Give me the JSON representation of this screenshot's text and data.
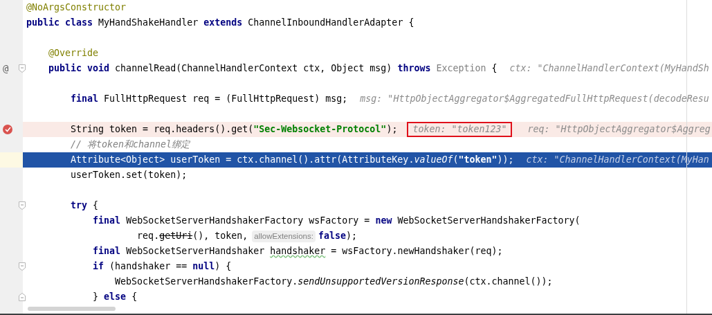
{
  "editor": {
    "lines": [
      {
        "pieces": [
          {
            "kind": "code",
            "tokens": [
              {
                "kind": "annotation",
                "text": "@NoArgsConstructor"
              }
            ]
          }
        ]
      },
      {
        "pieces": [
          {
            "kind": "code",
            "tokens": [
              {
                "kind": "keyword",
                "text": "public class "
              },
              {
                "kind": "plain",
                "text": "MyHandShakeHandler "
              },
              {
                "kind": "keyword",
                "text": "extends "
              },
              {
                "kind": "plain",
                "text": "ChannelInboundHandlerAdapter {"
              }
            ]
          }
        ]
      },
      {
        "gap_above": true,
        "pieces": [
          {
            "kind": "code",
            "tokens": [
              {
                "kind": "annotation",
                "text": "    @Override"
              }
            ]
          }
        ]
      },
      {
        "gutter_text": "@",
        "fold_open": true,
        "pieces": [
          {
            "kind": "code",
            "tokens": [
              {
                "kind": "keyword",
                "text": "    public void "
              },
              {
                "kind": "plain",
                "text": "channelRead(ChannelHandlerContext ctx, Object msg) "
              },
              {
                "kind": "keyword",
                "text": "throws "
              },
              {
                "kind": "dim",
                "text": "Exception "
              },
              {
                "kind": "plain",
                "text": "{"
              }
            ]
          },
          {
            "kind": "inline_value",
            "outlined": false,
            "text": "ctx: \"ChannelHandlerContext(MyHandSh"
          }
        ]
      },
      {
        "gap_above": true,
        "pieces": [
          {
            "kind": "code",
            "tokens": [
              {
                "kind": "keyword",
                "text": "        final "
              },
              {
                "kind": "plain",
                "text": "FullHttpRequest req = (FullHttpRequest) msg;"
              }
            ]
          },
          {
            "kind": "inline_value",
            "outlined": false,
            "text": "msg: \"HttpObjectAggregator$AggregatedFullHttpRequest(decodeResu"
          }
        ]
      },
      {
        "gap_above": true,
        "breakpoint": true,
        "pieces": [
          {
            "kind": "code",
            "tokens": [
              {
                "kind": "plain",
                "text": "        String token = req.headers().get("
              },
              {
                "kind": "string",
                "text": "\"Sec-Websocket-Protocol\""
              },
              {
                "kind": "plain",
                "text": ");"
              }
            ]
          },
          {
            "kind": "inline_value",
            "outlined": true,
            "text": "token: \"token123\""
          },
          {
            "kind": "inline_value",
            "outlined": false,
            "text": "req: \"HttpObjectAggregator$Aggreg"
          }
        ]
      },
      {
        "pieces": [
          {
            "kind": "code",
            "tokens": [
              {
                "kind": "comment",
                "text": "        // 将token和channel绑定"
              }
            ]
          }
        ]
      },
      {
        "current": true,
        "pieces": [
          {
            "kind": "code",
            "tokens": [
              {
                "kind": "plain",
                "text": "        Attribute<Object> userToken = ctx.channel().attr(AttributeKey."
              },
              {
                "kind": "static",
                "text": "valueOf"
              },
              {
                "kind": "plain",
                "text": "("
              },
              {
                "kind": "string",
                "text": "\"token\""
              },
              {
                "kind": "plain",
                "text": "));"
              }
            ]
          },
          {
            "kind": "inline_value",
            "outlined": false,
            "text": "ctx: \"ChannelHandlerContext(MyHan"
          }
        ]
      },
      {
        "pieces": [
          {
            "kind": "code",
            "tokens": [
              {
                "kind": "plain",
                "text": "        userToken.set(token);"
              }
            ]
          }
        ]
      },
      {
        "gap_above": true,
        "fold_open": true,
        "pieces": [
          {
            "kind": "code",
            "tokens": [
              {
                "kind": "keyword",
                "text": "        try "
              },
              {
                "kind": "plain",
                "text": "{"
              }
            ]
          }
        ]
      },
      {
        "pieces": [
          {
            "kind": "code",
            "tokens": [
              {
                "kind": "keyword",
                "text": "            final "
              },
              {
                "kind": "plain",
                "text": "WebSocketServerHandshakerFactory wsFactory = "
              },
              {
                "kind": "keyword",
                "text": "new "
              },
              {
                "kind": "plain",
                "text": "WebSocketServerHandshakerFactory("
              }
            ]
          }
        ]
      },
      {
        "pieces": [
          {
            "kind": "code",
            "tokens": [
              {
                "kind": "plain",
                "text": "                    req."
              },
              {
                "kind": "deprecated",
                "text": "getUri"
              },
              {
                "kind": "plain",
                "text": "(), token,"
              }
            ]
          },
          {
            "kind": "param_hint",
            "text": "allowExtensions:"
          },
          {
            "kind": "code",
            "tokens": [
              {
                "kind": "keyword",
                "text": "false"
              },
              {
                "kind": "plain",
                "text": ");"
              }
            ]
          }
        ]
      },
      {
        "pieces": [
          {
            "kind": "code",
            "tokens": [
              {
                "kind": "keyword",
                "text": "            final "
              },
              {
                "kind": "plain",
                "text": "WebSocketServerHandshaker "
              },
              {
                "kind": "warning",
                "text": "handshaker"
              },
              {
                "kind": "plain",
                "text": " = wsFactory.newHandshaker(req);"
              }
            ]
          }
        ]
      },
      {
        "fold_open": true,
        "pieces": [
          {
            "kind": "code",
            "tokens": [
              {
                "kind": "keyword",
                "text": "            if "
              },
              {
                "kind": "plain",
                "text": "(handshaker == "
              },
              {
                "kind": "keyword",
                "text": "null"
              },
              {
                "kind": "plain",
                "text": ") {"
              }
            ]
          }
        ]
      },
      {
        "pieces": [
          {
            "kind": "code",
            "tokens": [
              {
                "kind": "plain",
                "text": "                WebSocketServerHandshakerFactory."
              },
              {
                "kind": "static",
                "text": "sendUnsupportedVersionResponse"
              },
              {
                "kind": "plain",
                "text": "(ctx.channel());"
              }
            ]
          }
        ]
      },
      {
        "fold_close": true,
        "pieces": [
          {
            "kind": "code",
            "tokens": [
              {
                "kind": "plain",
                "text": "            } "
              },
              {
                "kind": "keyword",
                "text": "else "
              },
              {
                "kind": "plain",
                "text": "{"
              }
            ]
          }
        ]
      }
    ]
  }
}
